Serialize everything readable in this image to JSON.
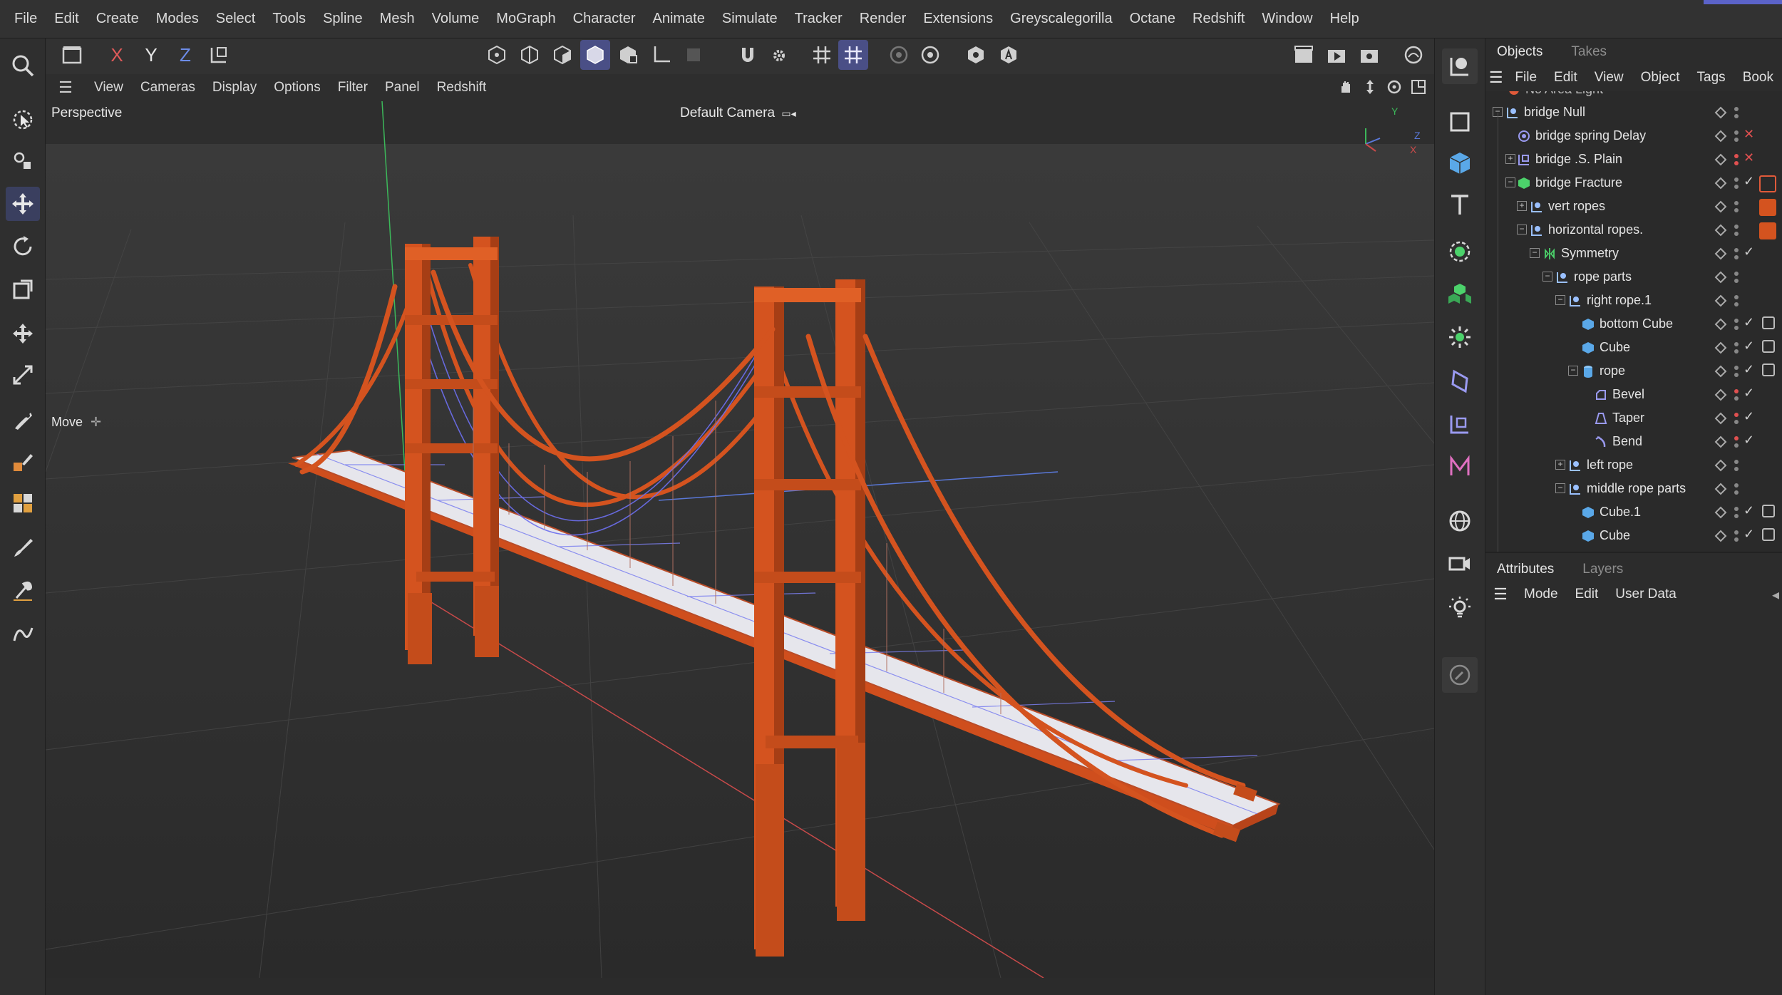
{
  "menubar": {
    "items": [
      "File",
      "Edit",
      "Create",
      "Modes",
      "Select",
      "Tools",
      "Spline",
      "Mesh",
      "Volume",
      "MoGraph",
      "Character",
      "Animate",
      "Simulate",
      "Tracker",
      "Render",
      "Extensions",
      "Greyscalegorilla",
      "Octane",
      "Redshift",
      "Window",
      "Help"
    ]
  },
  "toolbar": {
    "axis_x": "X",
    "axis_y": "Y",
    "axis_z": "Z",
    "colors": {
      "x": "#e05a5a",
      "y": "#e8e8e8",
      "z": "#6d8ce8",
      "accent": "#5b63c9"
    }
  },
  "viewport": {
    "menu": [
      "View",
      "Cameras",
      "Display",
      "Options",
      "Filter",
      "Panel",
      "Redshift"
    ],
    "projection": "Perspective",
    "camera": "Default Camera",
    "tool_label": "Move",
    "axis_y": "Y",
    "axis_z": "Z",
    "axis_x": "X",
    "bridge_color": "#d4531f",
    "deck_color": "#e4e4ea"
  },
  "objects_panel": {
    "tabs": [
      "Objects",
      "Takes"
    ],
    "menu": [
      "File",
      "Edit",
      "View",
      "Object",
      "Tags",
      "Book"
    ],
    "cut_row_label": "No Area Light",
    "rows": [
      {
        "label": "bridge Null",
        "icon": "null-icon"
      },
      {
        "label": "bridge spring Delay",
        "icon": "effector-icon"
      },
      {
        "label": "bridge .S. Plain",
        "icon": "null-icon"
      },
      {
        "label": "bridge Fracture",
        "icon": "fracture-icon"
      },
      {
        "label": "vert ropes",
        "icon": "null-icon"
      },
      {
        "label": "horizontal ropes.",
        "icon": "null-icon"
      },
      {
        "label": "Symmetry",
        "icon": "symmetry-icon"
      },
      {
        "label": "rope parts",
        "icon": "null-icon"
      },
      {
        "label": "right rope.1",
        "icon": "null-icon"
      },
      {
        "label": "bottom Cube",
        "icon": "cube-icon"
      },
      {
        "label": "Cube",
        "icon": "cube-icon"
      },
      {
        "label": "rope",
        "icon": "cylinder-icon"
      },
      {
        "label": "Bevel",
        "icon": "bevel-icon"
      },
      {
        "label": "Taper",
        "icon": "taper-icon"
      },
      {
        "label": "Bend",
        "icon": "bend-icon"
      },
      {
        "label": "left rope",
        "icon": "null-icon"
      },
      {
        "label": "middle rope parts",
        "icon": "null-icon"
      },
      {
        "label": "Cube.1",
        "icon": "cube-icon"
      },
      {
        "label": "Cube",
        "icon": "cube-icon"
      }
    ]
  },
  "attributes_panel": {
    "tabs": [
      "Attributes",
      "Layers"
    ],
    "menu": [
      "Mode",
      "Edit",
      "User Data"
    ]
  }
}
